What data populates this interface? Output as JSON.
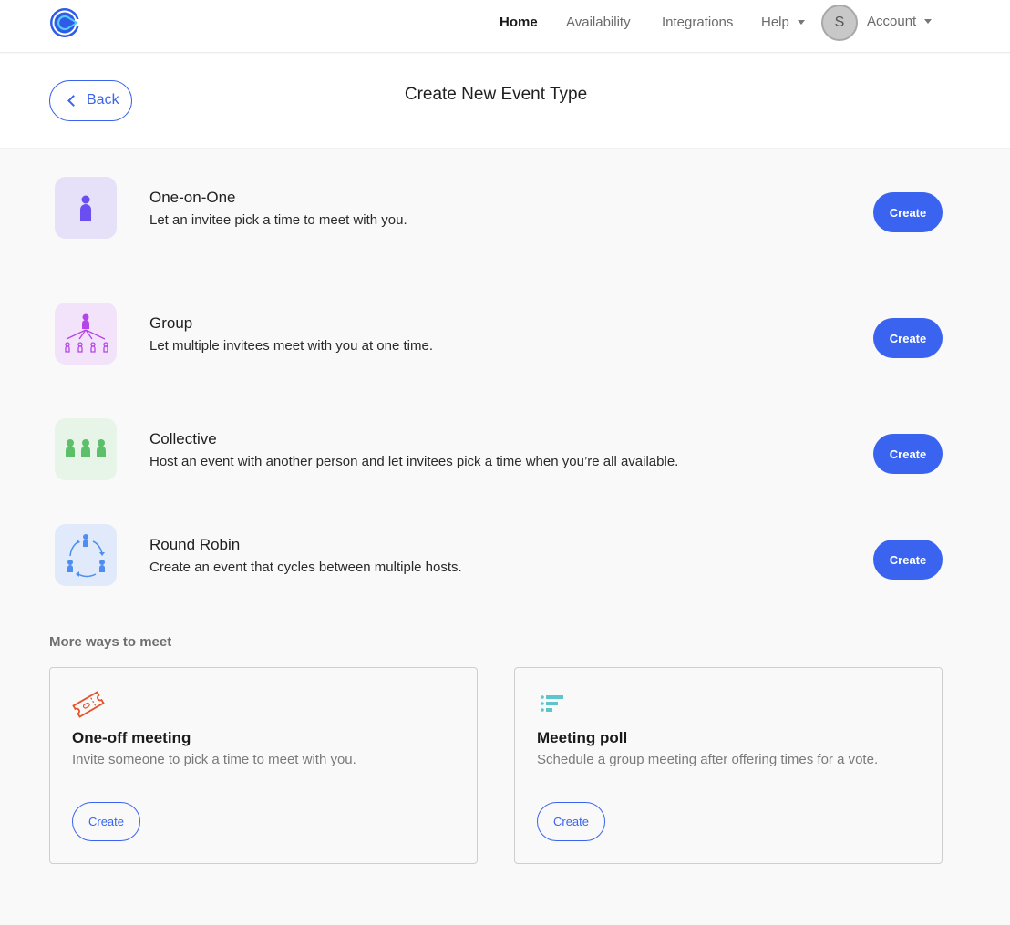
{
  "nav": {
    "logo": "calendly-logo",
    "links": [
      {
        "label": "Home",
        "active": true
      },
      {
        "label": "Availability",
        "active": false
      },
      {
        "label": "Integrations",
        "active": false
      },
      {
        "label": "Help",
        "active": false
      }
    ],
    "avatar_initial": "S",
    "account_label": "Account"
  },
  "header": {
    "back_label": "Back",
    "title": "Create New Event Type"
  },
  "event_types": [
    {
      "name": "One-on-One",
      "description": "Let an invitee pick a time to meet with you.",
      "button": "Create",
      "icon": "single-person-icon",
      "icon_color": "#6b4ef0",
      "icon_bg": "#e6e1f8"
    },
    {
      "name": "Group",
      "description": "Let multiple invitees meet with you at one time.",
      "button": "Create",
      "icon": "group-hierarchy-icon",
      "icon_color": "#b545e8",
      "icon_bg": "#f2e3fa"
    },
    {
      "name": "Collective",
      "description": "Host an event with another person and let invitees pick a time when you’re all available.",
      "button": "Create",
      "icon": "three-people-icon",
      "icon_color": "#5cc06a",
      "icon_bg": "#e6f5e8"
    },
    {
      "name": "Round Robin",
      "description": "Create an event that cycles between multiple hosts.",
      "button": "Create",
      "icon": "round-robin-icon",
      "icon_color": "#4d8ef0",
      "icon_bg": "#e1eafa"
    }
  ],
  "more": {
    "title": "More ways to meet",
    "cards": [
      {
        "title": "One-off meeting",
        "description": "Invite someone to pick a time to meet with you.",
        "button": "Create",
        "icon": "ticket-icon",
        "icon_color": "#e5532a"
      },
      {
        "title": "Meeting poll",
        "description": "Schedule a group meeting after offering times for a vote.",
        "button": "Create",
        "icon": "poll-list-icon",
        "icon_color": "#5fc4cc"
      }
    ]
  },
  "colors": {
    "primary": "#3a64f0",
    "background": "#f9f9f9"
  }
}
